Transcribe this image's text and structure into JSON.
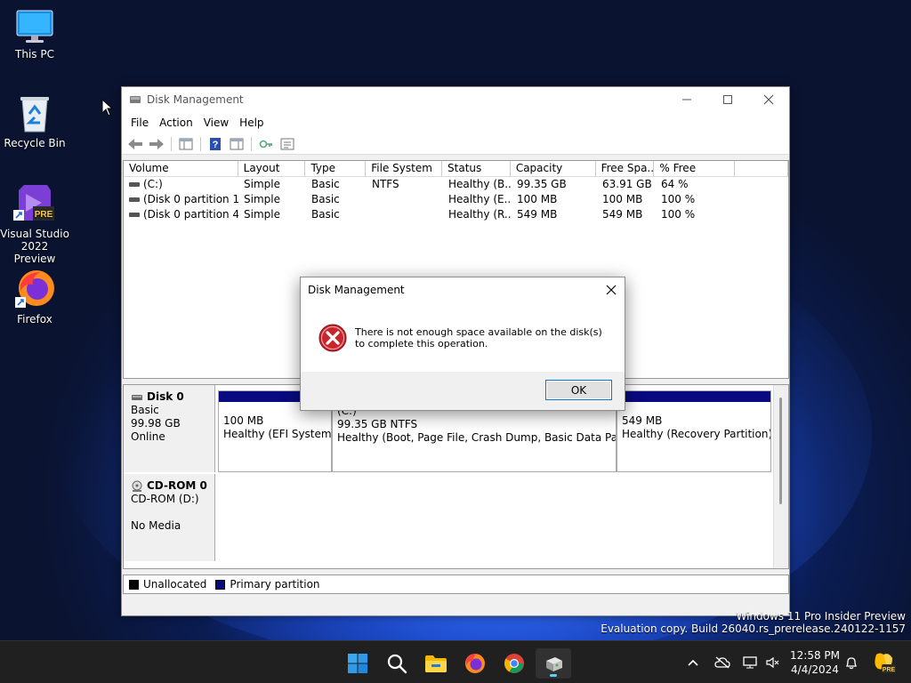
{
  "desktop": {
    "icons": [
      {
        "label": "This PC"
      },
      {
        "label": "Recycle Bin"
      },
      {
        "label": "Visual Studio 2022 Preview",
        "badge": "PRE"
      },
      {
        "label": "Firefox"
      }
    ]
  },
  "window": {
    "title": "Disk Management",
    "menu": [
      "File",
      "Action",
      "View",
      "Help"
    ],
    "columns": [
      "Volume",
      "Layout",
      "Type",
      "File System",
      "Status",
      "Capacity",
      "Free Spa...",
      "% Free",
      ""
    ],
    "volumes": [
      {
        "volume": "(C:)",
        "layout": "Simple",
        "type": "Basic",
        "fs": "NTFS",
        "status": "Healthy (B...",
        "capacity": "99.35 GB",
        "free": "63.91 GB",
        "pct": "64 %"
      },
      {
        "volume": "(Disk 0 partition 1)",
        "layout": "Simple",
        "type": "Basic",
        "fs": "",
        "status": "Healthy (E...",
        "capacity": "100 MB",
        "free": "100 MB",
        "pct": "100 %"
      },
      {
        "volume": "(Disk 0 partition 4)",
        "layout": "Simple",
        "type": "Basic",
        "fs": "",
        "status": "Healthy (R...",
        "capacity": "549 MB",
        "free": "549 MB",
        "pct": "100 %"
      }
    ],
    "disks": {
      "disk0": {
        "name": "Disk 0",
        "type": "Basic",
        "size": "99.98 GB",
        "state": "Online"
      },
      "cdrom0": {
        "name": "CD-ROM 0",
        "type": "CD-ROM (D:)",
        "media": "No Media"
      }
    },
    "partitions": [
      {
        "size": "100 MB",
        "status": "Healthy (EFI System Partition)"
      },
      {
        "label": "(C:)",
        "size": "99.35 GB NTFS",
        "status": "Healthy (Boot, Page File, Crash Dump, Basic Data Partition)"
      },
      {
        "size": "549 MB",
        "status": "Healthy (Recovery Partition)"
      }
    ],
    "legend": [
      "Unallocated",
      "Primary partition"
    ],
    "colors": {
      "unallocated": "#000000",
      "primary": "#0a0a80"
    }
  },
  "dialog": {
    "title": "Disk Management",
    "message": "There is not enough space available on the disk(s) to complete this operation.",
    "ok_label": "OK"
  },
  "watermark": {
    "line1": "Windows 11 Pro Insider Preview",
    "line2": "Evaluation copy. Build 26040.rs_prerelease.240122-1157"
  },
  "taskbar": {
    "time": "12:58 PM",
    "date": "4/4/2024",
    "copilot_badge": "PRE"
  }
}
